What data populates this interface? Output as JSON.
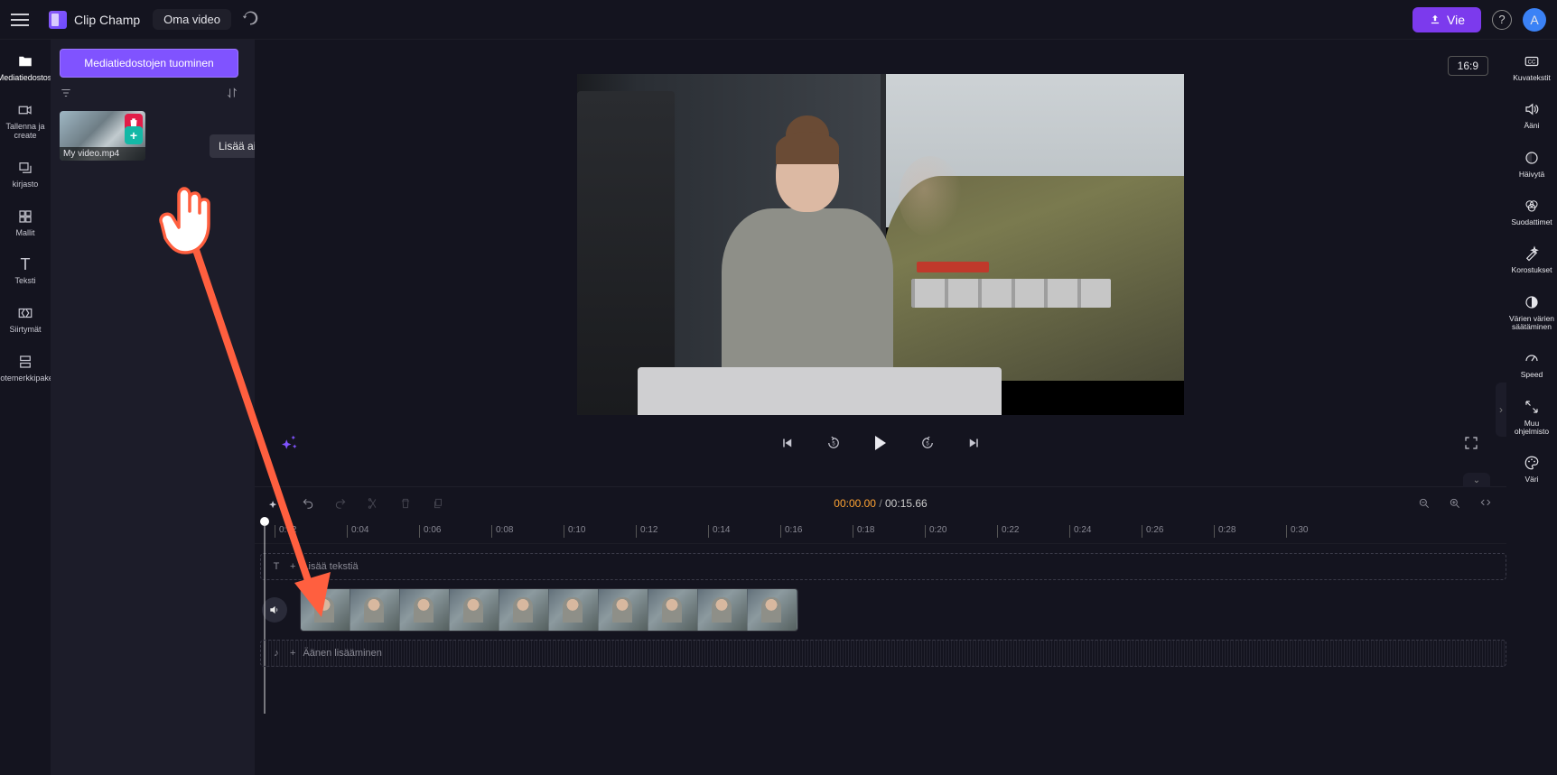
{
  "brand": {
    "name": "Clip Champ"
  },
  "project": {
    "name": "Oma video"
  },
  "topbar": {
    "export": "Vie",
    "avatar_initial": "A"
  },
  "leftrail": {
    "media": "Mediatiedostosi",
    "record": "Tallenna ja create",
    "library": "kirjasto",
    "templates": "Mallit",
    "text": "Teksti",
    "transitions": "Siirtymät",
    "brandkit": "Tuotemerkkipaketit"
  },
  "media_panel": {
    "import": "Mediatiedostojen tuominen",
    "file_name": "My video.mp4",
    "tooltip": "Lisää aikajanalle"
  },
  "preview": {
    "aspect": "16:9"
  },
  "timeline": {
    "current": "00:00.00",
    "total": "00:15.66",
    "ticks": [
      "0:02",
      "0:04",
      "0:06",
      "0:08",
      "0:10",
      "0:12",
      "0:14",
      "0:16",
      "0:18",
      "0:20",
      "0:22",
      "0:24",
      "0:26",
      "0:28",
      "0:30"
    ],
    "text_track": "Lisää tekstiä",
    "audio_track": "Äänen lisääminen"
  },
  "rightrail": {
    "captions": "Kuvatekstit",
    "audio": "Ääni",
    "fade": "Häivytä",
    "filters": "Suodattimet",
    "highlights": "Korostukset",
    "coloradjust": "Värien värien säätäminen",
    "speed": "Speed",
    "other": "Muu ohjelmisto",
    "color": "Väri"
  }
}
